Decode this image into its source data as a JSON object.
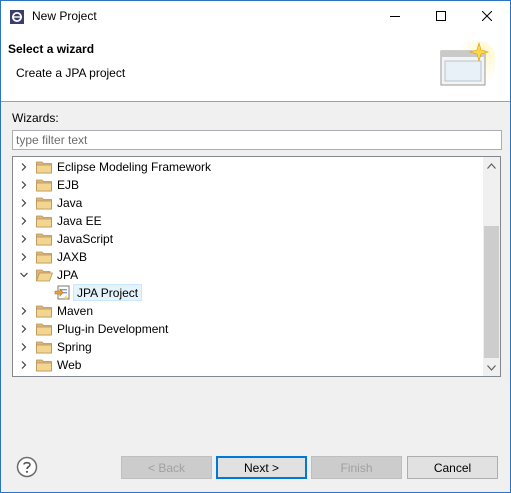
{
  "window": {
    "title": "New Project"
  },
  "banner": {
    "title": "Select a wizard",
    "description": "Create a JPA project"
  },
  "wizards": {
    "label": "Wizards:",
    "filter_placeholder": "type filter text"
  },
  "tree": {
    "items": [
      {
        "label": "Eclipse Modeling Framework",
        "expanded": false
      },
      {
        "label": "EJB",
        "expanded": false
      },
      {
        "label": "Java",
        "expanded": false
      },
      {
        "label": "Java EE",
        "expanded": false
      },
      {
        "label": "JavaScript",
        "expanded": false
      },
      {
        "label": "JAXB",
        "expanded": false
      },
      {
        "label": "JPA",
        "expanded": true
      },
      {
        "label": "JPA Project",
        "child": true,
        "selected": true
      },
      {
        "label": "Maven",
        "expanded": false
      },
      {
        "label": "Plug-in Development",
        "expanded": false
      },
      {
        "label": "Spring",
        "expanded": false
      },
      {
        "label": "Web",
        "expanded": false
      }
    ]
  },
  "buttons": {
    "back": "< Back",
    "next": "Next >",
    "finish": "Finish",
    "cancel": "Cancel"
  },
  "colors": {
    "accent": "#0078d7",
    "selection": "#e5f3fb",
    "folder": "#dcb67a"
  }
}
